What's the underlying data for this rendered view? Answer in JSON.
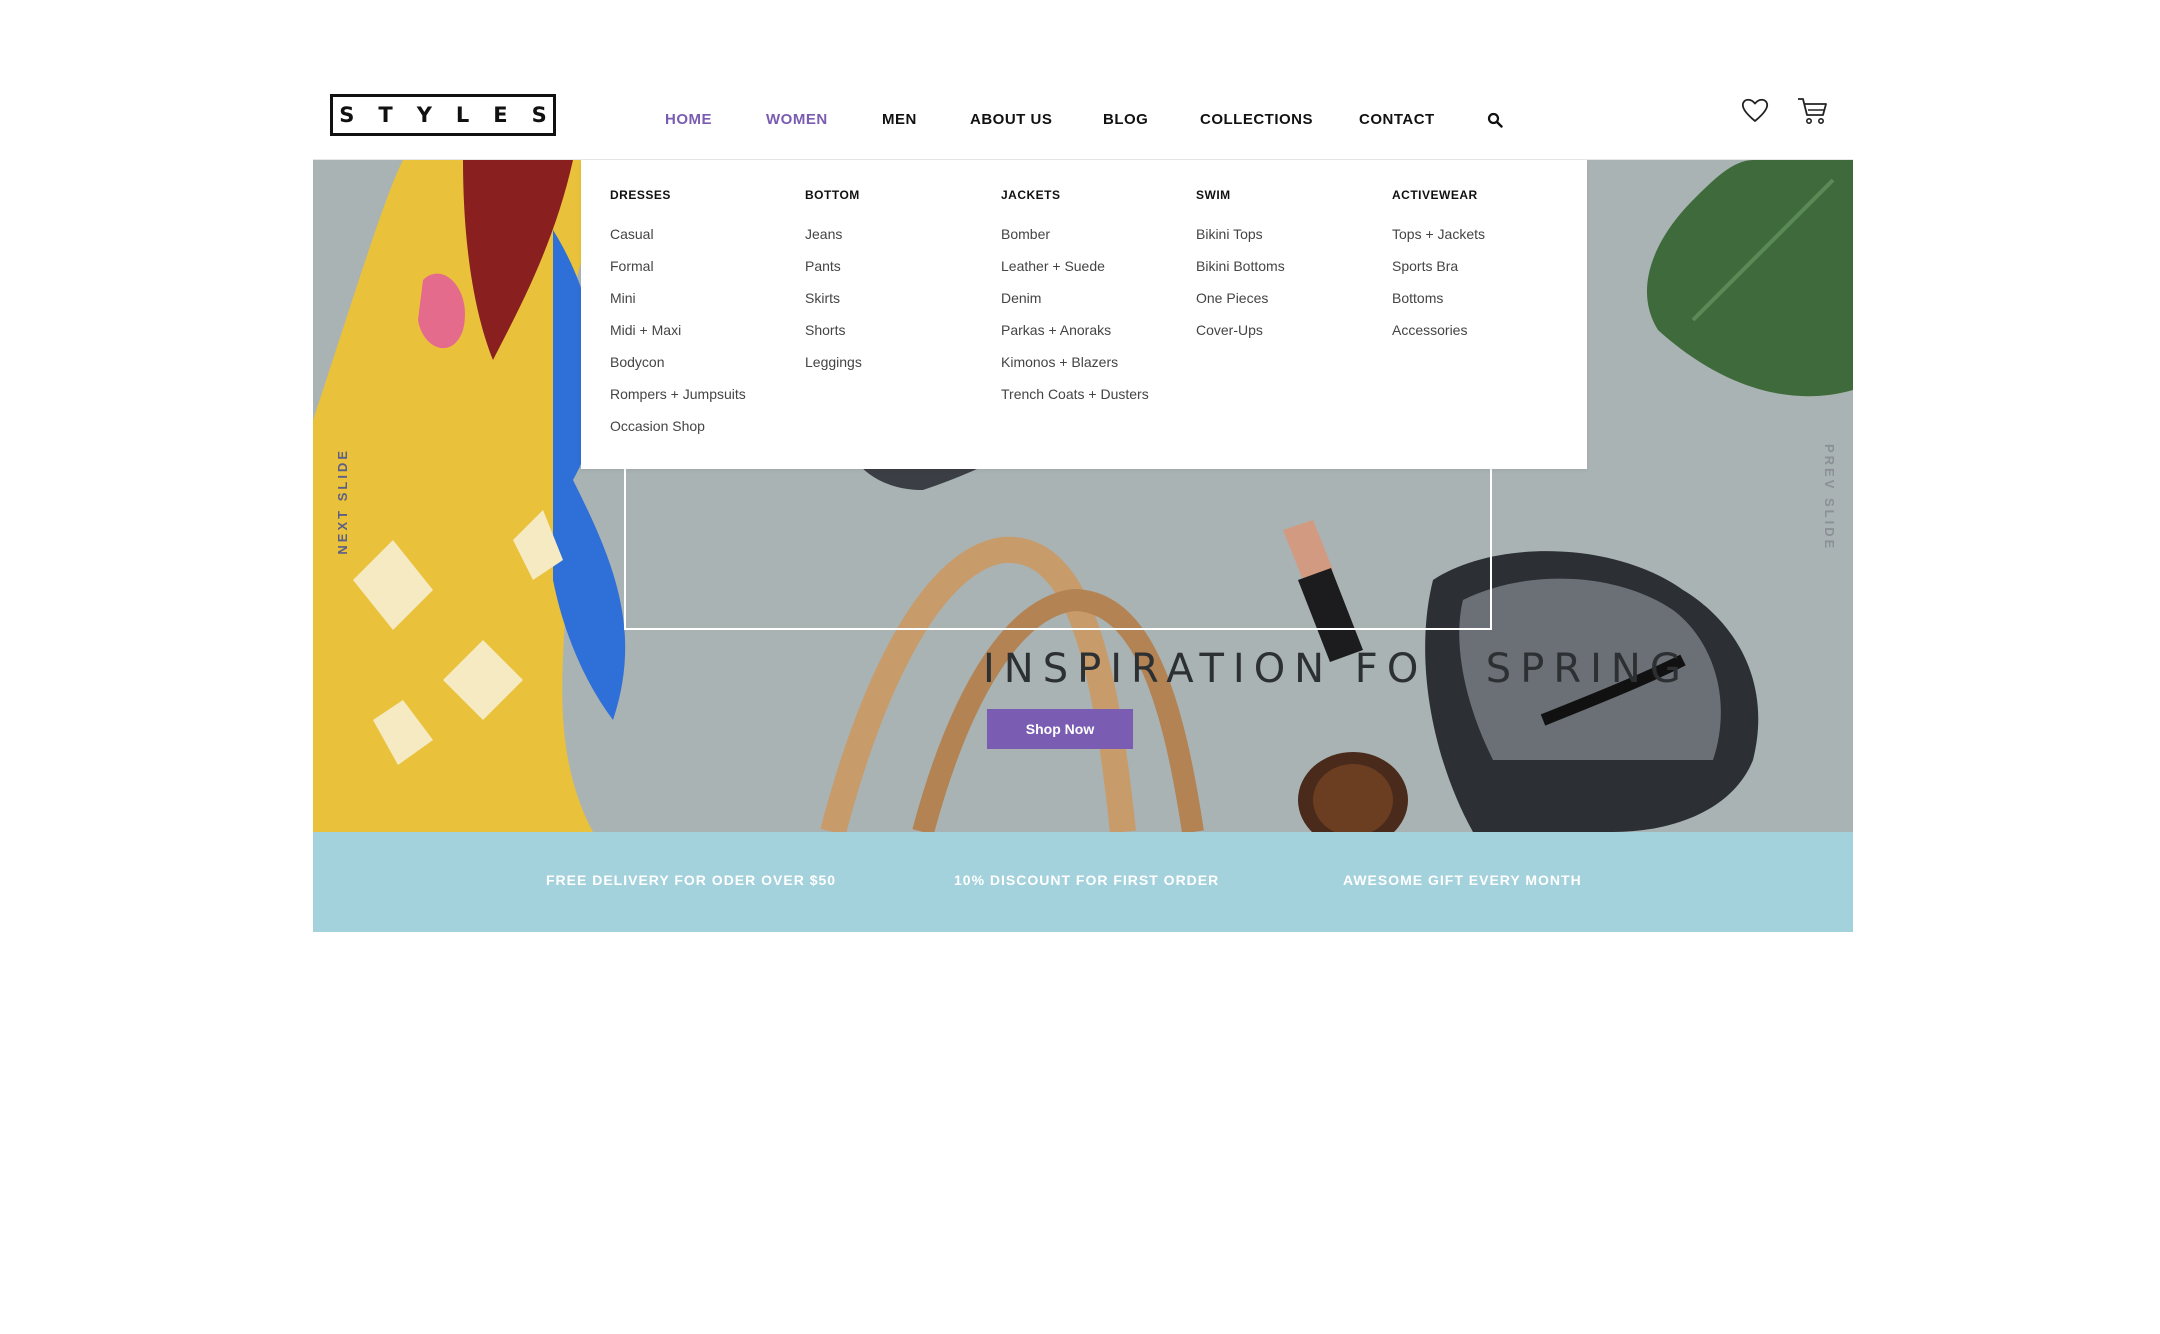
{
  "header": {
    "logo": "STYLES",
    "nav": [
      "HOME",
      "WOMEN",
      "MEN",
      "ABOUT US",
      "BLOG",
      "COLLECTIONS",
      "CONTACT"
    ],
    "active_item": "HOME",
    "icons": [
      "search-icon",
      "heart-icon",
      "cart-icon"
    ]
  },
  "mega_menu": {
    "columns": [
      {
        "title": "DRESSES",
        "items": [
          "Casual",
          "Formal",
          "Mini",
          "Midi + Maxi",
          "Bodycon",
          "Rompers + Jumpsuits",
          "Occasion Shop"
        ]
      },
      {
        "title": "BOTTOM",
        "items": [
          "Jeans",
          "Pants",
          "Skirts",
          "Shorts",
          "Leggings"
        ]
      },
      {
        "title": "JACKETS",
        "items": [
          "Bomber",
          "Leather + Suede",
          "Denim",
          "Parkas + Anoraks",
          "Kimonos + Blazers",
          "Trench Coats + Dusters"
        ]
      },
      {
        "title": "SWIM",
        "items": [
          "Bikini Tops",
          "Bikini Bottoms",
          "One Pieces",
          "Cover-Ups"
        ]
      },
      {
        "title": "ACTIVEWEAR",
        "items": [
          "Tops + Jackets",
          "Sports Bra",
          "Bottoms",
          "Accessories"
        ]
      }
    ]
  },
  "hero": {
    "title": "INSPIRATION FOR SPRING",
    "button": "Shop Now",
    "next_slide": "NEXT SLIDE",
    "prev_slide": "PREV SLIDE"
  },
  "info_band": [
    "FREE DELIVERY FOR ODER OVER $50",
    "10% DISCOUNT FOR FIRST ORDER",
    "AWESOME GIFT EVERY MONTH"
  ],
  "colors": {
    "accent": "#7a5cb3",
    "info_band": "#a3d1dc",
    "hero_background": "#aab4b4"
  }
}
